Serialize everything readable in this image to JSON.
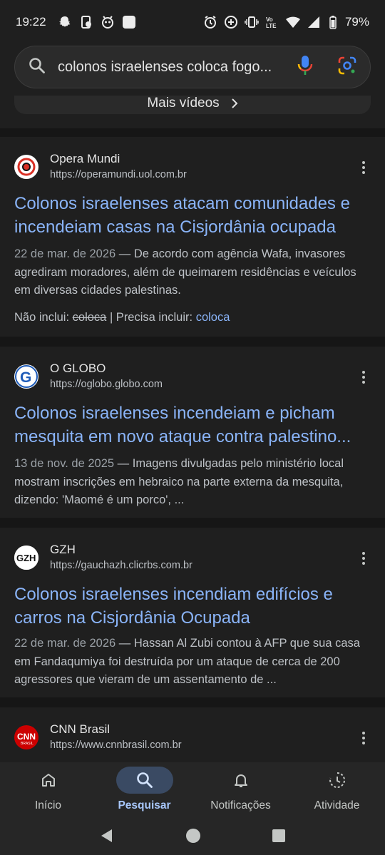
{
  "status_bar": {
    "time": "19:22",
    "battery": "79%",
    "left_icons": [
      "snapchat-icon",
      "phone-app-icon",
      "alien-app-icon",
      "square-app-icon"
    ],
    "right_icons": [
      "alarm-icon",
      "data-saver-icon",
      "vibrate-icon",
      "volte-icon",
      "wifi-icon",
      "signal-icon",
      "battery-icon"
    ]
  },
  "search": {
    "query": "colonos israelenses coloca fogo...",
    "icons": [
      "search-icon",
      "mic-icon",
      "google-lens-icon"
    ]
  },
  "more_videos": {
    "label": "Mais vídeos"
  },
  "results": [
    {
      "source": "Opera Mundi",
      "url": "https://operamundi.uol.com.br",
      "title": "Colonos israelenses atacam comunidades e incendeiam casas na Cisjordânia ocupada",
      "date": "22 de mar. de 2026",
      "snippet": " — De acordo com agência Wafa, invasores agrediram moradores, além de queimarem residências e veículos em diversas cidades palestinas.",
      "missing_label": "Não inclui:",
      "missing_term": "coloca",
      "must_include_label": "| Precisa incluir:",
      "must_include_term": "coloca"
    },
    {
      "source": "O GLOBO",
      "url": "https://oglobo.globo.com",
      "title": "Colonos israelenses incendeiam e picham mesquita em novo ataque contra palestino...",
      "date": "13 de nov. de 2025",
      "snippet": " — Imagens divulgadas pelo ministério local mostram inscrições em hebraico na parte externa da mesquita, dizendo: 'Maomé é um porco', ..."
    },
    {
      "source": "GZH",
      "url": "https://gauchazh.clicrbs.com.br",
      "title": "Colonos israelenses incendiam edifícios e carros na Cisjordânia Ocupada",
      "date": "22 de mar. de 2026",
      "snippet": " — Hassan Al Zubi contou à AFP que sua casa em Fandaqumiya foi destruída por um ataque de cerca de 200 agressores que vieram de um assentamento de ..."
    },
    {
      "source": "CNN Brasil",
      "url": "https://www.cnnbrasil.com.br"
    }
  ],
  "bottom_nav": [
    {
      "label": "Início",
      "icon": "home-icon",
      "active": false
    },
    {
      "label": "Pesquisar",
      "icon": "search-icon",
      "active": true
    },
    {
      "label": "Notificações",
      "icon": "bell-icon",
      "active": false
    },
    {
      "label": "Atividade",
      "icon": "activity-icon",
      "active": false
    }
  ],
  "colors": {
    "link": "#8ab4f8",
    "active_nav": "#a8c7fa",
    "background": "#1f1f1f"
  }
}
